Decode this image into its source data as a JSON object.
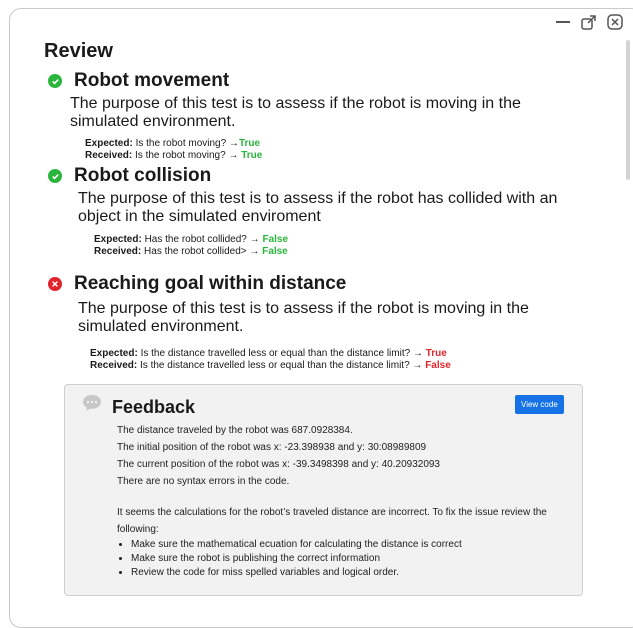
{
  "window": {
    "minimize_icon": "minus-icon",
    "restore_icon": "external-icon",
    "close_icon": "close-icon"
  },
  "review": {
    "title": "Review",
    "sections": [
      {
        "status": "pass",
        "heading": "Robot movement",
        "description": "The purpose of this test is to assess if the robot is moving in the simulated environment.",
        "expected_label": "Expected:",
        "expected_text": "Is the robot moving? →",
        "expected_value": "True",
        "received_label": "Received:",
        "received_text": "Is the robot moving? →",
        "received_value": "True"
      },
      {
        "status": "pass",
        "heading": "Robot collision",
        "description": "The purpose of this test is to assess if the robot has collided with an object in the simulated enviroment",
        "expected_label": "Expected:",
        "expected_text": "Has the robot collided? →",
        "expected_value": "False",
        "received_label": "Received:",
        "received_text": "Has the robot collided> →",
        "received_value": "False"
      },
      {
        "status": "fail",
        "heading": "Reaching goal within distance",
        "description": "The purpose of this test is to assess if the robot is moving in the simulated environment.",
        "expected_label": "Expected:",
        "expected_text": "Is the distance travelled less or equal than the distance limit? →",
        "expected_value": "True",
        "received_label": "Received:",
        "received_text": "Is the distance travelled less or equal than the distance limit? →",
        "received_value": "False"
      }
    ]
  },
  "feedback": {
    "title": "Feedback",
    "view_code_label": "View code",
    "lines": [
      "The distance traveled by the robot was 687.0928384.",
      "The initial position of the robot was x: -23.398938 and y: 30:08989809",
      "The current position of the robot was x: -39.3498398 and y: 40.20932093",
      "There are no syntax errors in the code."
    ],
    "paragraph": "It seems the calculations for the robot’s traveled distance are incorrect. To fix the issue review the following:",
    "bullets": [
      "Make sure the mathematical ecuation for calculating the distance is correct",
      "Make sure the robot is publishing the correct information",
      "Review the code for miss spelled variables and logical order."
    ]
  },
  "colors": {
    "pass": "#2ab53c",
    "fail": "#e0242b",
    "accent": "#1673e6"
  }
}
